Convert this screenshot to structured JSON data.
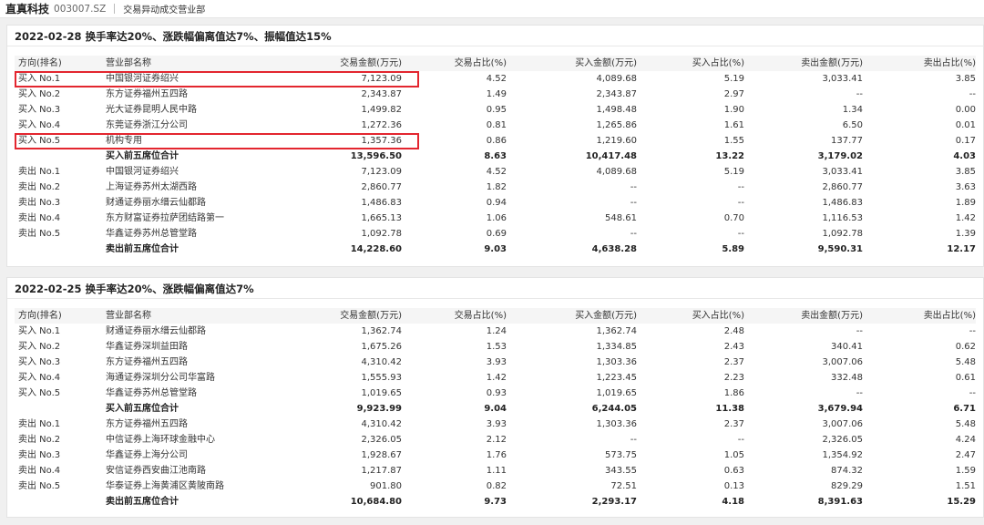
{
  "header": {
    "stock_name": "直真科技",
    "stock_code": "003007.SZ",
    "subtitle": "交易异动成交营业部"
  },
  "columns": [
    "方向(排名)",
    "营业部名称",
    "交易金额(万元)",
    "交易占比(%)",
    "买入金额(万元)",
    "买入占比(%)",
    "卖出金额(万元)",
    "卖出占比(%)"
  ],
  "panels": [
    {
      "title": "2022-02-28 换手率达20%、涨跌幅偏离值达7%、振幅值达15%",
      "buy_rows": [
        [
          "买入 No.1",
          "中国银河证券绍兴",
          "7,123.09",
          "4.52",
          "4,089.68",
          "5.19",
          "3,033.41",
          "3.85"
        ],
        [
          "买入 No.2",
          "东方证券福州五四路",
          "2,343.87",
          "1.49",
          "2,343.87",
          "2.97",
          "--",
          "--"
        ],
        [
          "买入 No.3",
          "光大证券昆明人民中路",
          "1,499.82",
          "0.95",
          "1,498.48",
          "1.90",
          "1.34",
          "0.00"
        ],
        [
          "买入 No.4",
          "东莞证券浙江分公司",
          "1,272.36",
          "0.81",
          "1,265.86",
          "1.61",
          "6.50",
          "0.01"
        ],
        [
          "买入 No.5",
          "机构专用",
          "1,357.36",
          "0.86",
          "1,219.60",
          "1.55",
          "137.77",
          "0.17"
        ]
      ],
      "buy_total": [
        "买入前五席位合计",
        "13,596.50",
        "8.63",
        "10,417.48",
        "13.22",
        "3,179.02",
        "4.03"
      ],
      "sell_rows": [
        [
          "卖出 No.1",
          "中国银河证券绍兴",
          "7,123.09",
          "4.52",
          "4,089.68",
          "5.19",
          "3,033.41",
          "3.85"
        ],
        [
          "卖出 No.2",
          "上海证券苏州太湖西路",
          "2,860.77",
          "1.82",
          "--",
          "--",
          "2,860.77",
          "3.63"
        ],
        [
          "卖出 No.3",
          "财通证券丽水缙云仙都路",
          "1,486.83",
          "0.94",
          "--",
          "--",
          "1,486.83",
          "1.89"
        ],
        [
          "卖出 No.4",
          "东方财富证券拉萨团结路第一",
          "1,665.13",
          "1.06",
          "548.61",
          "0.70",
          "1,116.53",
          "1.42"
        ],
        [
          "卖出 No.5",
          "华鑫证券苏州总管堂路",
          "1,092.78",
          "0.69",
          "--",
          "--",
          "1,092.78",
          "1.39"
        ]
      ],
      "sell_total": [
        "卖出前五席位合计",
        "14,228.60",
        "9.03",
        "4,638.28",
        "5.89",
        "9,590.31",
        "12.17"
      ]
    },
    {
      "title": "2022-02-25 换手率达20%、涨跌幅偏离值达7%",
      "buy_rows": [
        [
          "买入 No.1",
          "财通证券丽水缙云仙都路",
          "1,362.74",
          "1.24",
          "1,362.74",
          "2.48",
          "--",
          "--"
        ],
        [
          "买入 No.2",
          "华鑫证券深圳益田路",
          "1,675.26",
          "1.53",
          "1,334.85",
          "2.43",
          "340.41",
          "0.62"
        ],
        [
          "买入 No.3",
          "东方证券福州五四路",
          "4,310.42",
          "3.93",
          "1,303.36",
          "2.37",
          "3,007.06",
          "5.48"
        ],
        [
          "买入 No.4",
          "海通证券深圳分公司华富路",
          "1,555.93",
          "1.42",
          "1,223.45",
          "2.23",
          "332.48",
          "0.61"
        ],
        [
          "买入 No.5",
          "华鑫证券苏州总管堂路",
          "1,019.65",
          "0.93",
          "1,019.65",
          "1.86",
          "--",
          "--"
        ]
      ],
      "buy_total": [
        "买入前五席位合计",
        "9,923.99",
        "9.04",
        "6,244.05",
        "11.38",
        "3,679.94",
        "6.71"
      ],
      "sell_rows": [
        [
          "卖出 No.1",
          "东方证券福州五四路",
          "4,310.42",
          "3.93",
          "1,303.36",
          "2.37",
          "3,007.06",
          "5.48"
        ],
        [
          "卖出 No.2",
          "中信证券上海环球金融中心",
          "2,326.05",
          "2.12",
          "--",
          "--",
          "2,326.05",
          "4.24"
        ],
        [
          "卖出 No.3",
          "华鑫证券上海分公司",
          "1,928.67",
          "1.76",
          "573.75",
          "1.05",
          "1,354.92",
          "2.47"
        ],
        [
          "卖出 No.4",
          "安信证券西安曲江池南路",
          "1,217.87",
          "1.11",
          "343.55",
          "0.63",
          "874.32",
          "1.59"
        ],
        [
          "卖出 No.5",
          "华泰证券上海黄浦区黄陂南路",
          "901.80",
          "0.82",
          "72.51",
          "0.13",
          "829.29",
          "1.51"
        ]
      ],
      "sell_total": [
        "卖出前五席位合计",
        "10,684.80",
        "9.73",
        "2,293.17",
        "4.18",
        "8,391.63",
        "15.29"
      ]
    }
  ],
  "highlight_color": "#e3262f"
}
